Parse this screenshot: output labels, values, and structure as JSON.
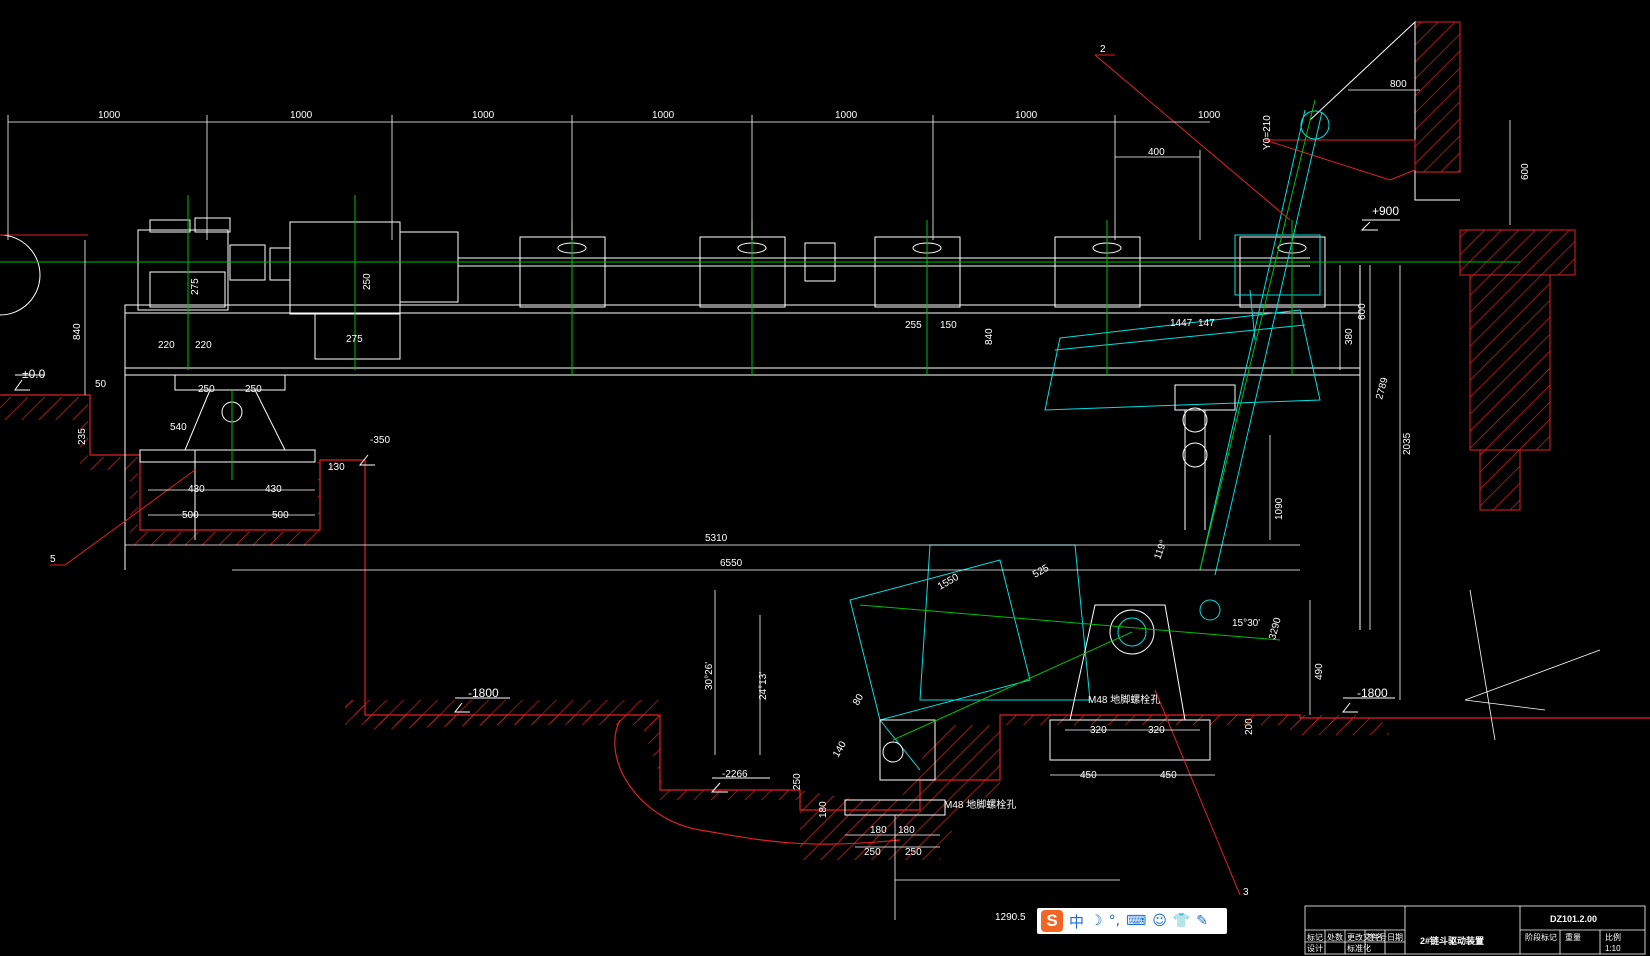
{
  "title_block": {
    "drawing_number": "DZ101.2.00",
    "drawing_title": "2#链斗驱动装置",
    "row_labels": [
      "标记",
      "处数",
      "更改文件号",
      "签名",
      "日期"
    ],
    "row_labels2": [
      "设计",
      "标准化"
    ],
    "right_labels": [
      "阶段标记",
      "重量",
      "比例"
    ],
    "scale": "1:10"
  },
  "levels": {
    "top_ref": "±0.0",
    "plus900": "+900",
    "minus350": "-350",
    "minus1800_left": "-1800",
    "minus1800_right": "-1800",
    "minus2266": "-2266"
  },
  "leaders": {
    "tag2": "2",
    "tag3": "3",
    "tag5": "5"
  },
  "dims": {
    "span_a": "1000",
    "span_b": "1000",
    "span_c": "1000",
    "span_d": "1000",
    "span_e": "1000",
    "span_f": "1000",
    "span_g": "1000",
    "d800": "800",
    "y0": "Y0=210",
    "d400": "400",
    "d600a": "600",
    "d840a": "840",
    "d275a": "275",
    "d250a": "250",
    "d220a": "220",
    "d220b": "220",
    "d275b": "275",
    "d255": "255",
    "d150": "150",
    "d840b": "840",
    "d1447": "1447",
    "d147": "147",
    "d380": "380",
    "d600b": "600",
    "d2789": "2789",
    "d2035": "2035",
    "d50": "50",
    "d250b": "250",
    "d250c": "250",
    "d235": "235",
    "d540": "540",
    "d430a": "430",
    "d430b": "430",
    "d130": "130",
    "d500a": "500",
    "d500b": "500",
    "d5310": "5310",
    "d6550": "6550",
    "d1090": "1090",
    "d490": "490",
    "a119": "119°",
    "a15": "15°30'",
    "a30": "30°26'",
    "a24": "24°13'",
    "d1550": "1550",
    "d525": "525",
    "d80": "80",
    "d140": "140",
    "d250d": "250",
    "d180a": "180",
    "d180b": "180",
    "d180c": "180",
    "d250e": "250",
    "d250f": "250",
    "d1290": "1290.5",
    "d320a": "320",
    "d320b": "320",
    "d200": "200",
    "d450a": "450",
    "d450b": "450",
    "d3290": "3290"
  },
  "notes": {
    "anchor_right": "M48 地脚螺栓孔",
    "anchor_left": "M48 地脚螺栓孔"
  },
  "ime_toolbar": {
    "logo": "S",
    "mode": "中"
  },
  "colors": {
    "background": "#000000",
    "dimension": "#ffffff",
    "centerline": "#00c000",
    "section": "#ff2020",
    "moving_part": "#00e0e0",
    "level_mark": "#ffffff"
  }
}
